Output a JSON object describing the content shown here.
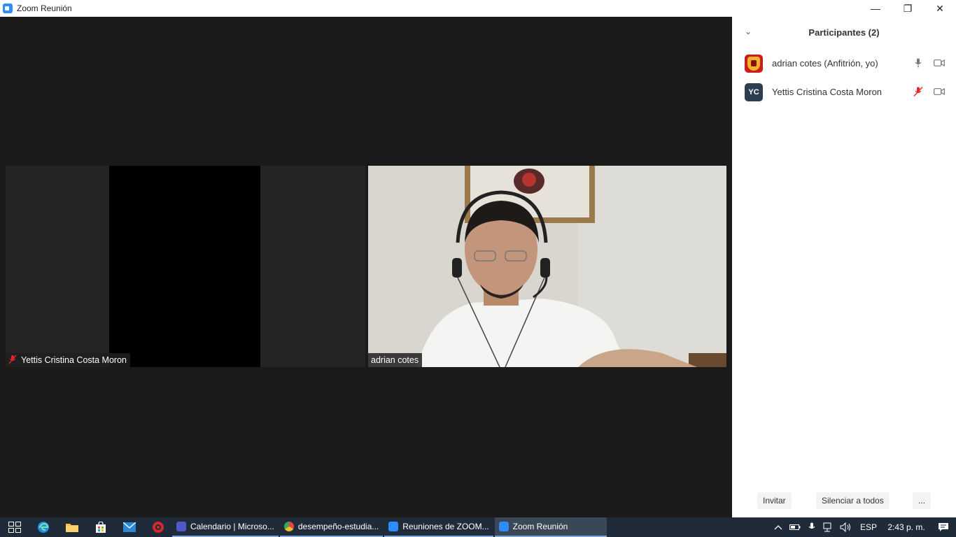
{
  "window": {
    "title": "Zoom Reunión",
    "controls": {
      "minimize": "—",
      "restore": "❐",
      "close": "✕"
    }
  },
  "tiles": [
    {
      "name": "Yettis Cristina Costa Moron",
      "muted": true
    },
    {
      "name": "adrian cotes",
      "muted": false
    }
  ],
  "panel": {
    "collapse": "⌄",
    "title": "Participantes (2)",
    "participants": [
      {
        "name": "adrian cotes (Anfitrión, yo)",
        "avatar": "logo",
        "mic": "mic-icon",
        "camera": "camera-off-icon"
      },
      {
        "name": "Yettis Cristina Costa Moron",
        "avatar": "YC",
        "mic": "mic-muted-icon",
        "camera": "camera-off-icon"
      }
    ],
    "buttons": {
      "invite": "Invitar",
      "mute_all": "Silenciar a todos",
      "more": "..."
    }
  },
  "taskbar": {
    "apps": [
      {
        "label": "Calendario | Microso...",
        "color": "#5059c9"
      },
      {
        "label": "desempeño-estudia...",
        "color": "#e8453c"
      },
      {
        "label": "Reuniones de ZOOM...",
        "color": "#2d8cff"
      },
      {
        "label": "Zoom Reunión",
        "color": "#2d8cff",
        "active": true
      }
    ],
    "tray": {
      "language": "ESP",
      "time": "2:43 p. m."
    }
  },
  "colors": {
    "accent": "#2d8cff",
    "muted": "#e02828",
    "meeting_bg": "#1a1a1a",
    "taskbar_bg": "#1f2b38"
  }
}
